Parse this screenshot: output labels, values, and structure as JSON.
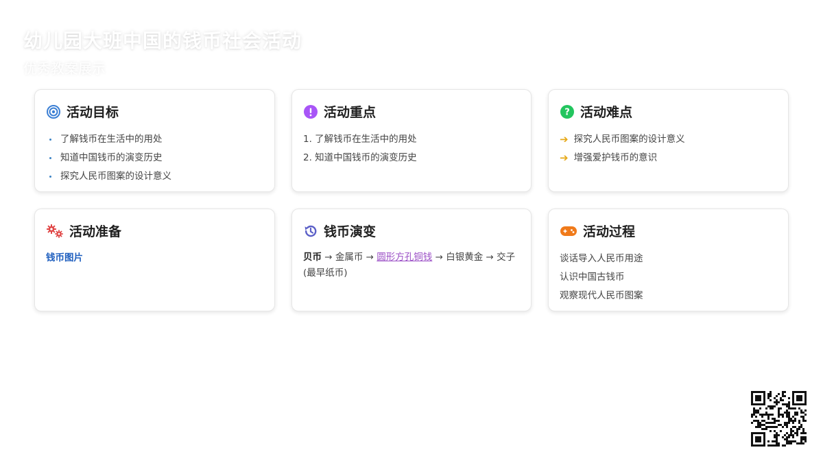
{
  "header": {
    "title": "幼儿园大班中国的钱币社会活动",
    "subtitle": "优秀教案展示"
  },
  "cards": {
    "goals": {
      "title": "活动目标",
      "icon": "target-icon",
      "items": [
        "了解钱币在生活中的用处",
        "知道中国钱币的演变历史",
        "探究人民币图案的设计意义"
      ]
    },
    "keypoints": {
      "title": "活动重点",
      "icon": "exclamation-icon",
      "items": [
        "1. 了解钱币在生活中的用处",
        "2. 知道中国钱币的演变历史"
      ]
    },
    "difficulties": {
      "title": "活动难点",
      "icon": "question-icon",
      "items": [
        "探究人民币图案的设计意义",
        "增强爱护钱币的意识"
      ]
    },
    "preparation": {
      "title": "活动准备",
      "icon": "gears-icon",
      "link": "钱币图片"
    },
    "evolution": {
      "title": "钱币演变",
      "icon": "history-icon",
      "parts": [
        "贝币",
        " → 金属币 → ",
        "圆形方孔铜钱",
        " → 白银黄金 → 交子(最早纸币)"
      ]
    },
    "process": {
      "title": "活动过程",
      "icon": "gamepad-icon",
      "items": [
        "谈话导入人民币用途",
        "认识中国古钱币",
        "观察现代人民币图案"
      ]
    }
  },
  "colors": {
    "goals_icon": "#3b7fd4",
    "keypoints_icon": "#a855f7",
    "difficulties_icon": "#22c55e",
    "preparation_icon": "#e04545",
    "evolution_icon": "#5b5fc7",
    "process_icon": "#f07a1a",
    "arrow": "#e6a817"
  }
}
